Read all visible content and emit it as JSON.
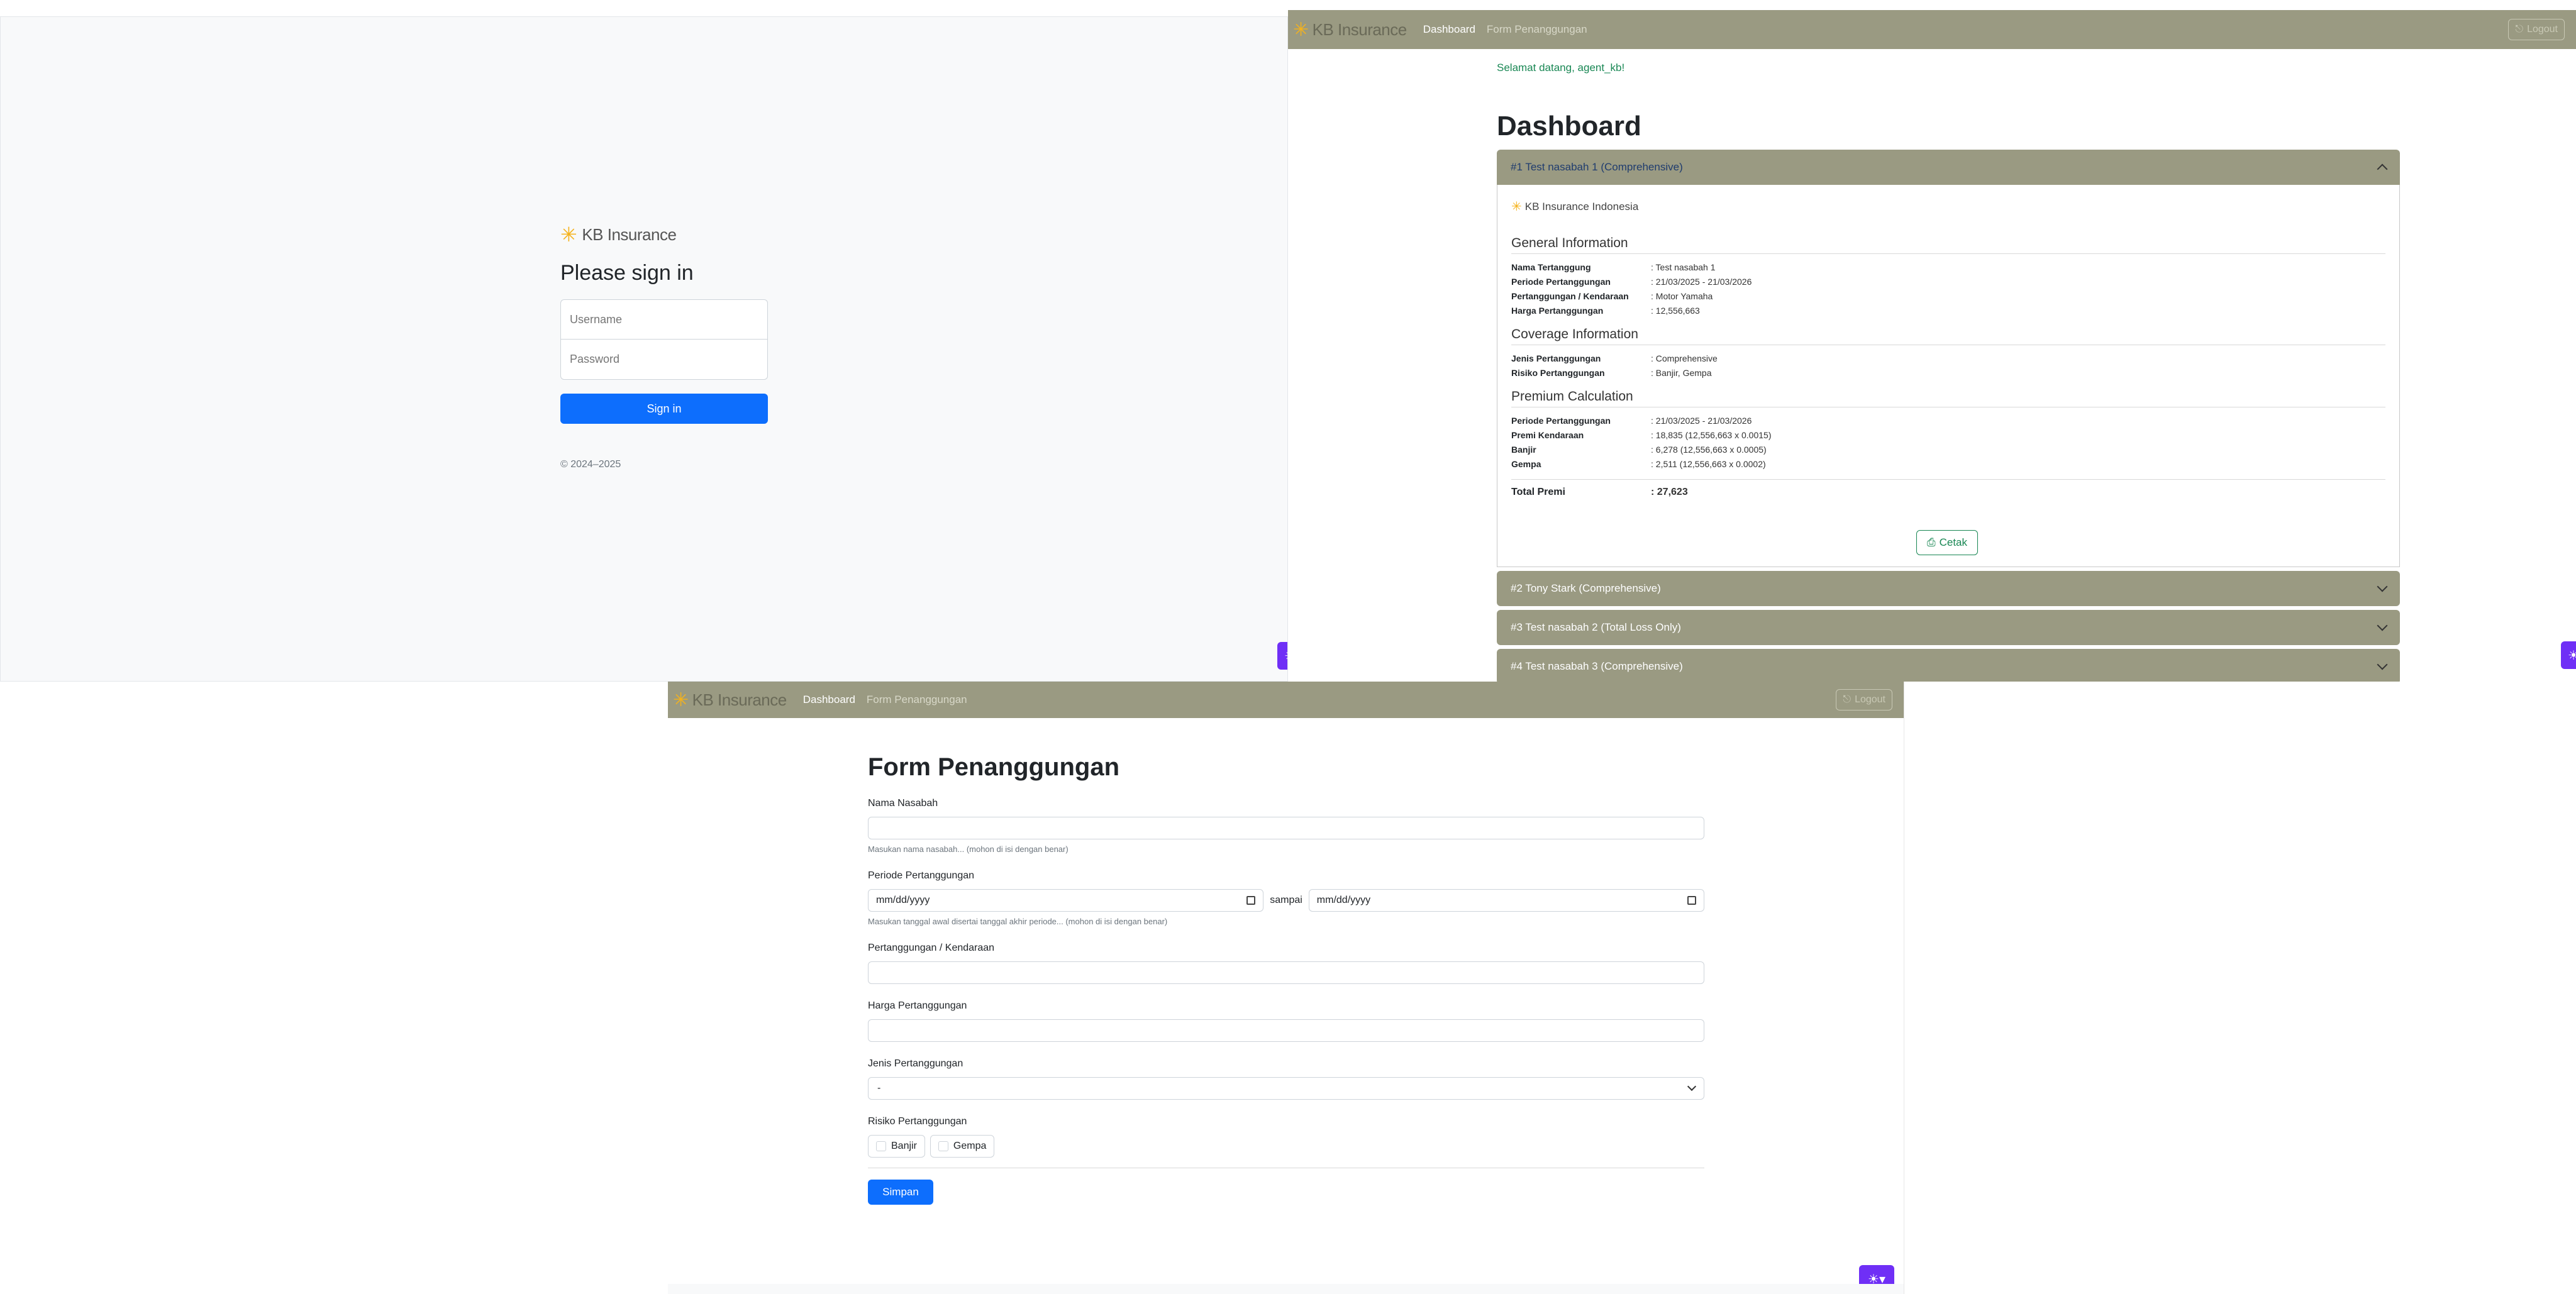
{
  "brand": {
    "name": "KB Insurance",
    "accent": "#f5b21b",
    "nav_color": "#9a9a82",
    "primary": "#0d6efd"
  },
  "login": {
    "title": "Please sign in",
    "username_placeholder": "Username",
    "password_placeholder": "Password",
    "signin_label": "Sign in",
    "copyright": "© 2024–2025"
  },
  "nav": {
    "dashboard": "Dashboard",
    "form": "Form Penanggungan",
    "logout": "Logout"
  },
  "dashboard": {
    "welcome": "Selamat datang, agent_kb!",
    "title": "Dashboard",
    "mini_logo": "KB Insurance Indonesia",
    "items": [
      {
        "label": "#1 Test nasabah 1 (Comprehensive)"
      },
      {
        "label": "#2 Tony Stark (Comprehensive)"
      },
      {
        "label": "#3 Test nasabah 2 (Total Loss Only)"
      },
      {
        "label": "#4 Test nasabah 3 (Comprehensive)"
      }
    ],
    "general": {
      "title": "General Information",
      "rows": [
        {
          "k": "Nama Tertanggung",
          "v": ": Test nasabah 1"
        },
        {
          "k": "Periode Pertanggungan",
          "v": ": 21/03/2025 - 21/03/2026"
        },
        {
          "k": "Pertanggungan / Kendaraan",
          "v": ": Motor Yamaha"
        },
        {
          "k": "Harga Pertanggungan",
          "v": ": 12,556,663"
        }
      ]
    },
    "coverage": {
      "title": "Coverage Information",
      "rows": [
        {
          "k": "Jenis Pertanggungan",
          "v": ": Comprehensive"
        },
        {
          "k": "Risiko Pertanggungan",
          "v": ": Banjir, Gempa"
        }
      ]
    },
    "premium": {
      "title": "Premium Calculation",
      "rows": [
        {
          "k": "Periode Pertanggungan",
          "v": ": 21/03/2025 - 21/03/2026"
        },
        {
          "k": "Premi Kendaraan",
          "v": ": 18,835 (12,556,663 x 0.0015)"
        },
        {
          "k": "Banjir",
          "v": ": 6,278 (12,556,663 x 0.0005)"
        },
        {
          "k": "Gempa",
          "v": ": 2,511 (12,556,663 x 0.0002)"
        }
      ],
      "total_label": "Total Premi",
      "total_value": ": 27,623"
    },
    "print_label": "Cetak"
  },
  "form": {
    "title": "Form Penanggungan",
    "nama_label": "Nama Nasabah",
    "nama_help": "Masukan nama nasabah... (mohon di isi dengan benar)",
    "periode_label": "Periode Pertanggungan",
    "date_placeholder": "mm/dd/yyyy",
    "sampai": "sampai",
    "periode_help": "Masukan tanggal awal disertai tanggal akhir periode... (mohon di isi dengan benar)",
    "kendaraan_label": "Pertanggungan / Kendaraan",
    "harga_label": "Harga Pertanggungan",
    "jenis_label": "Jenis Pertanggungan",
    "jenis_value": "-",
    "risiko_label": "Risiko Pertanggungan",
    "risiko_options": [
      "Banjir",
      "Gempa"
    ],
    "submit_label": "Simpan"
  }
}
